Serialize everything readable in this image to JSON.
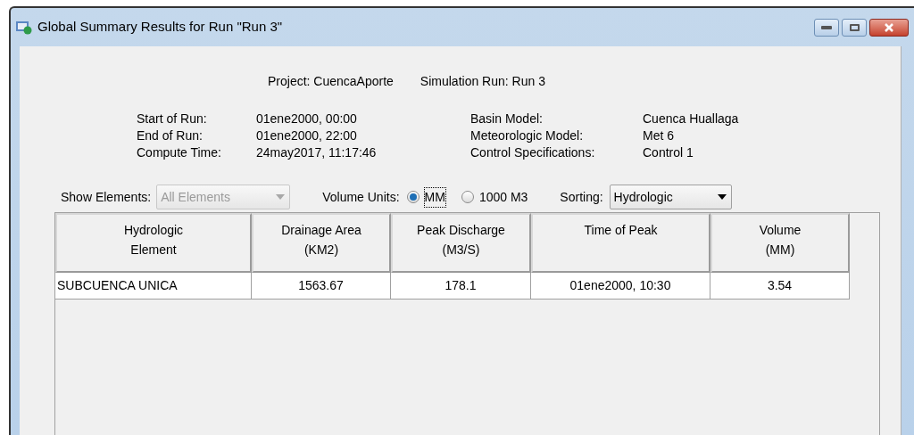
{
  "window": {
    "title": "Global Summary Results for Run \"Run 3\""
  },
  "header": {
    "project": "Project: CuencaAporte",
    "simulation_run": "Simulation Run: Run 3"
  },
  "info_left": [
    {
      "label": "Start of Run:",
      "value": "01ene2000, 00:00"
    },
    {
      "label": "End of Run:",
      "value": "01ene2000, 22:00"
    },
    {
      "label": "Compute Time:",
      "value": "24may2017, 11:17:46"
    }
  ],
  "info_right": [
    {
      "label": "Basin Model:",
      "value": "Cuenca Huallaga"
    },
    {
      "label": "Meteorologic Model:",
      "value": "Met 6"
    },
    {
      "label": "Control Specifications:",
      "value": "Control 1"
    }
  ],
  "show_elements": {
    "label": "Show Elements:",
    "value": "All Elements",
    "disabled": true
  },
  "volume_units": {
    "label": "Volume Units:",
    "options": [
      {
        "label": "MM",
        "selected": true
      },
      {
        "label": "1000 M3",
        "selected": false
      }
    ]
  },
  "sorting": {
    "label": "Sorting:",
    "value": "Hydrologic",
    "disabled": false
  },
  "table": {
    "columns": [
      "Hydrologic\nElement",
      "Drainage Area\n(KM2)",
      "Peak Discharge\n(M3/S)",
      "Time of Peak",
      "Volume\n(MM)"
    ],
    "rows": [
      [
        "SUBCUENCA UNICA",
        "1563.67",
        "178.1",
        "01ene2000, 10:30",
        "3.54"
      ]
    ]
  }
}
